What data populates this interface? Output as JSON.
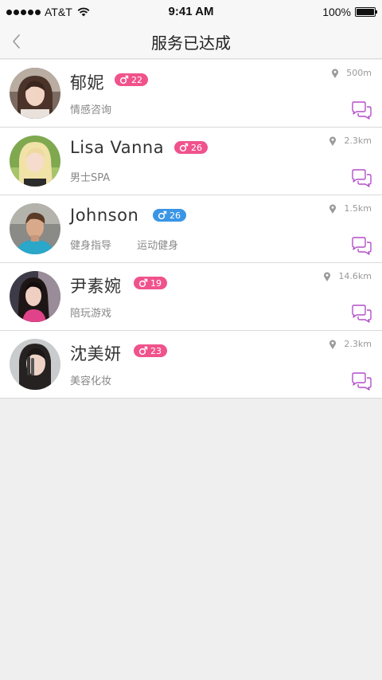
{
  "status_bar": {
    "carrier": "AT&T",
    "time": "9:41 AM",
    "battery": "100%"
  },
  "nav": {
    "title": "服务已达成",
    "back_icon": "chevron-left-icon"
  },
  "colors": {
    "female_badge": "#f0538c",
    "male_badge": "#3a95e6",
    "chat_icon": "#b34fc9",
    "background": "#efeff0"
  },
  "list": {
    "items": [
      {
        "name": "郁妮",
        "gender": "female",
        "age": "22",
        "tags": [
          "情感咨询"
        ],
        "distance": "500m"
      },
      {
        "name": "Lisa Vanna",
        "gender": "female",
        "age": "26",
        "tags": [
          "男士SPA"
        ],
        "distance": "2.3km"
      },
      {
        "name": "Johnson",
        "gender": "male",
        "age": "26",
        "tags": [
          "健身指导",
          "运动健身"
        ],
        "distance": "1.5km"
      },
      {
        "name": "尹素婉",
        "gender": "female",
        "age": "19",
        "tags": [
          "陪玩游戏"
        ],
        "distance": "14.6km"
      },
      {
        "name": "沈美妍",
        "gender": "female",
        "age": "23",
        "tags": [
          "美容化妆"
        ],
        "distance": "2.3km"
      }
    ]
  }
}
